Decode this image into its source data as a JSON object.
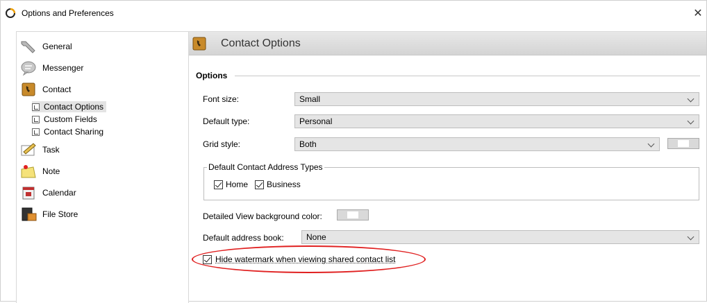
{
  "window": {
    "title": "Options and Preferences",
    "close_glyph": "✕"
  },
  "sidebar": {
    "items": [
      {
        "label": "General",
        "icon": "wrench-icon"
      },
      {
        "label": "Messenger",
        "icon": "chat-bubble-icon"
      },
      {
        "label": "Contact",
        "icon": "contact-book-icon"
      },
      {
        "label": "Task",
        "icon": "task-pencil-icon"
      },
      {
        "label": "Note",
        "icon": "note-pin-icon"
      },
      {
        "label": "Calendar",
        "icon": "calendar-icon"
      },
      {
        "label": "File Store",
        "icon": "file-store-icon"
      }
    ],
    "contact_subitems": [
      {
        "label": "Contact Options",
        "selected": true
      },
      {
        "label": "Custom Fields",
        "selected": false
      },
      {
        "label": "Contact Sharing",
        "selected": false
      }
    ]
  },
  "main": {
    "header_title": "Contact Options",
    "section_title": "Options",
    "font_size": {
      "label": "Font size:",
      "value": "Small"
    },
    "default_type": {
      "label": "Default type:",
      "value": "Personal"
    },
    "grid_style": {
      "label": "Grid style:",
      "value": "Both"
    },
    "address_types": {
      "legend": "Default Contact Address Types",
      "home": {
        "label": "Home",
        "checked": true
      },
      "business": {
        "label": "Business",
        "checked": true
      }
    },
    "detailed_view": {
      "label": "Detailed View background color:"
    },
    "default_address_book": {
      "label": "Default address book:",
      "value": "None"
    },
    "hide_watermark": {
      "label": "Hide watermark when viewing shared contact list",
      "checked": true
    }
  },
  "colors": {
    "highlight": "#e02020",
    "header_band": "#dcdcdc",
    "dropdown_bg": "#e5e5e5"
  }
}
